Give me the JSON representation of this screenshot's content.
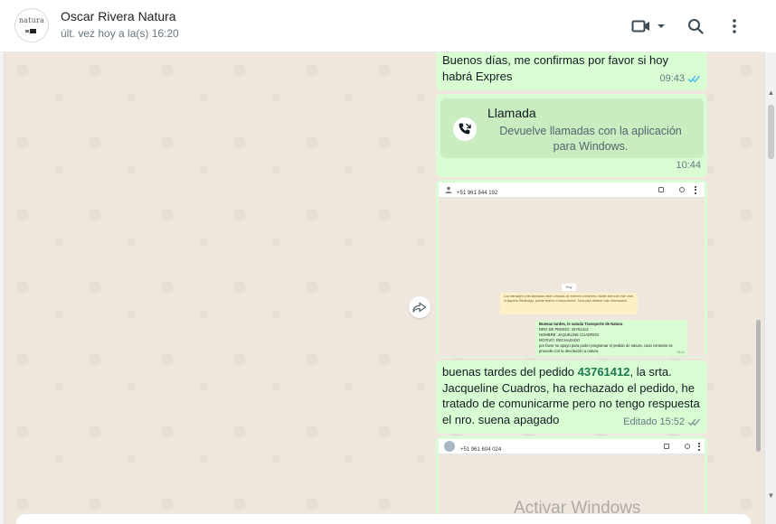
{
  "header": {
    "avatar_text": "natura",
    "contact_name": "Oscar Rivera Natura",
    "last_seen": "últ. vez hoy a la(s) 16:20",
    "icons": [
      "video-icon",
      "chevron-down-icon",
      "search-icon",
      "more-vertical-icon"
    ]
  },
  "messages": [
    {
      "text": "Buenos días, me confirmas por favor si hoy habrá Expres",
      "time": "09:43",
      "status": "read"
    },
    {
      "call_title": "Llamada",
      "call_desc": "Devuelve llamadas con la aplicación para Windows.",
      "time": "10:44"
    },
    {
      "image_header_number": "+51 961 844 192",
      "image_notice_label": "Hoy",
      "image_notice_text": "Los mensajes y las llamadas están cifrados de extremo a extremo. Nadie fuera de este chat, ni siquiera WhatsApp, puede leerlos ni escucharlos. Toca para obtener más información.",
      "image_bubble_lines": [
        "Buenas tardes, le saluda Transporte de Natura",
        "NRO DE PEDIDO: 43761412",
        "NOMBRE: JAQUELINE CUADROS",
        "MOTIVO: RECHAZADO",
        "por favor su apoyo para poder programar el pedido de natura, caso contrario se procede con la devolución a natura"
      ],
      "image_bubble_time": "15:11"
    },
    {
      "text_before": "buenas tardes del pedido ",
      "phone": "43761412",
      "text_after": ", la srta. Jacqueline Cuadros, ha rechazado el pedido, he tratado de comunicarme pero no tengo respuesta el nro. suena apagado",
      "edited_label": "Editado",
      "time": "15:52",
      "status": "sent"
    },
    {
      "image_header_number": "+51 961 604 024"
    }
  ],
  "watermark": "Activar Windows",
  "colors": {
    "bubble": "#d9fdd3",
    "chat_bg": "#efe7dd",
    "tick_read": "#53bdeb",
    "link": "#1c7a50"
  }
}
